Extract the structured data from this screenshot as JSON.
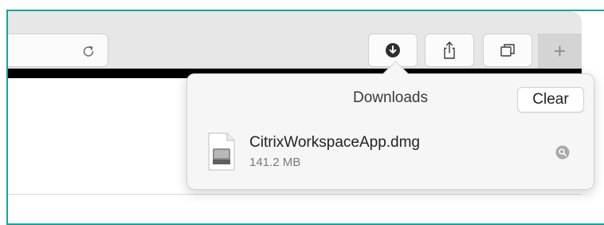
{
  "toolbar": {
    "icons": {
      "reload": "reload-icon",
      "downloads": "download-arrow-icon",
      "share": "share-icon",
      "tabs": "tab-overview-icon"
    },
    "new_tab_label": "+"
  },
  "downloads_popover": {
    "title": "Downloads",
    "clear_label": "Clear",
    "items": [
      {
        "file_name": "CitrixWorkspaceApp.dmg",
        "file_size": "141.2 MB",
        "icon": "dmg-file-icon",
        "action_icon": "magnifier-reveal-icon"
      }
    ]
  },
  "colors": {
    "highlight_frame": "#1aa399",
    "toolbar_bg": "#e7e7e7",
    "popover_bg": "#f6f6f6"
  }
}
